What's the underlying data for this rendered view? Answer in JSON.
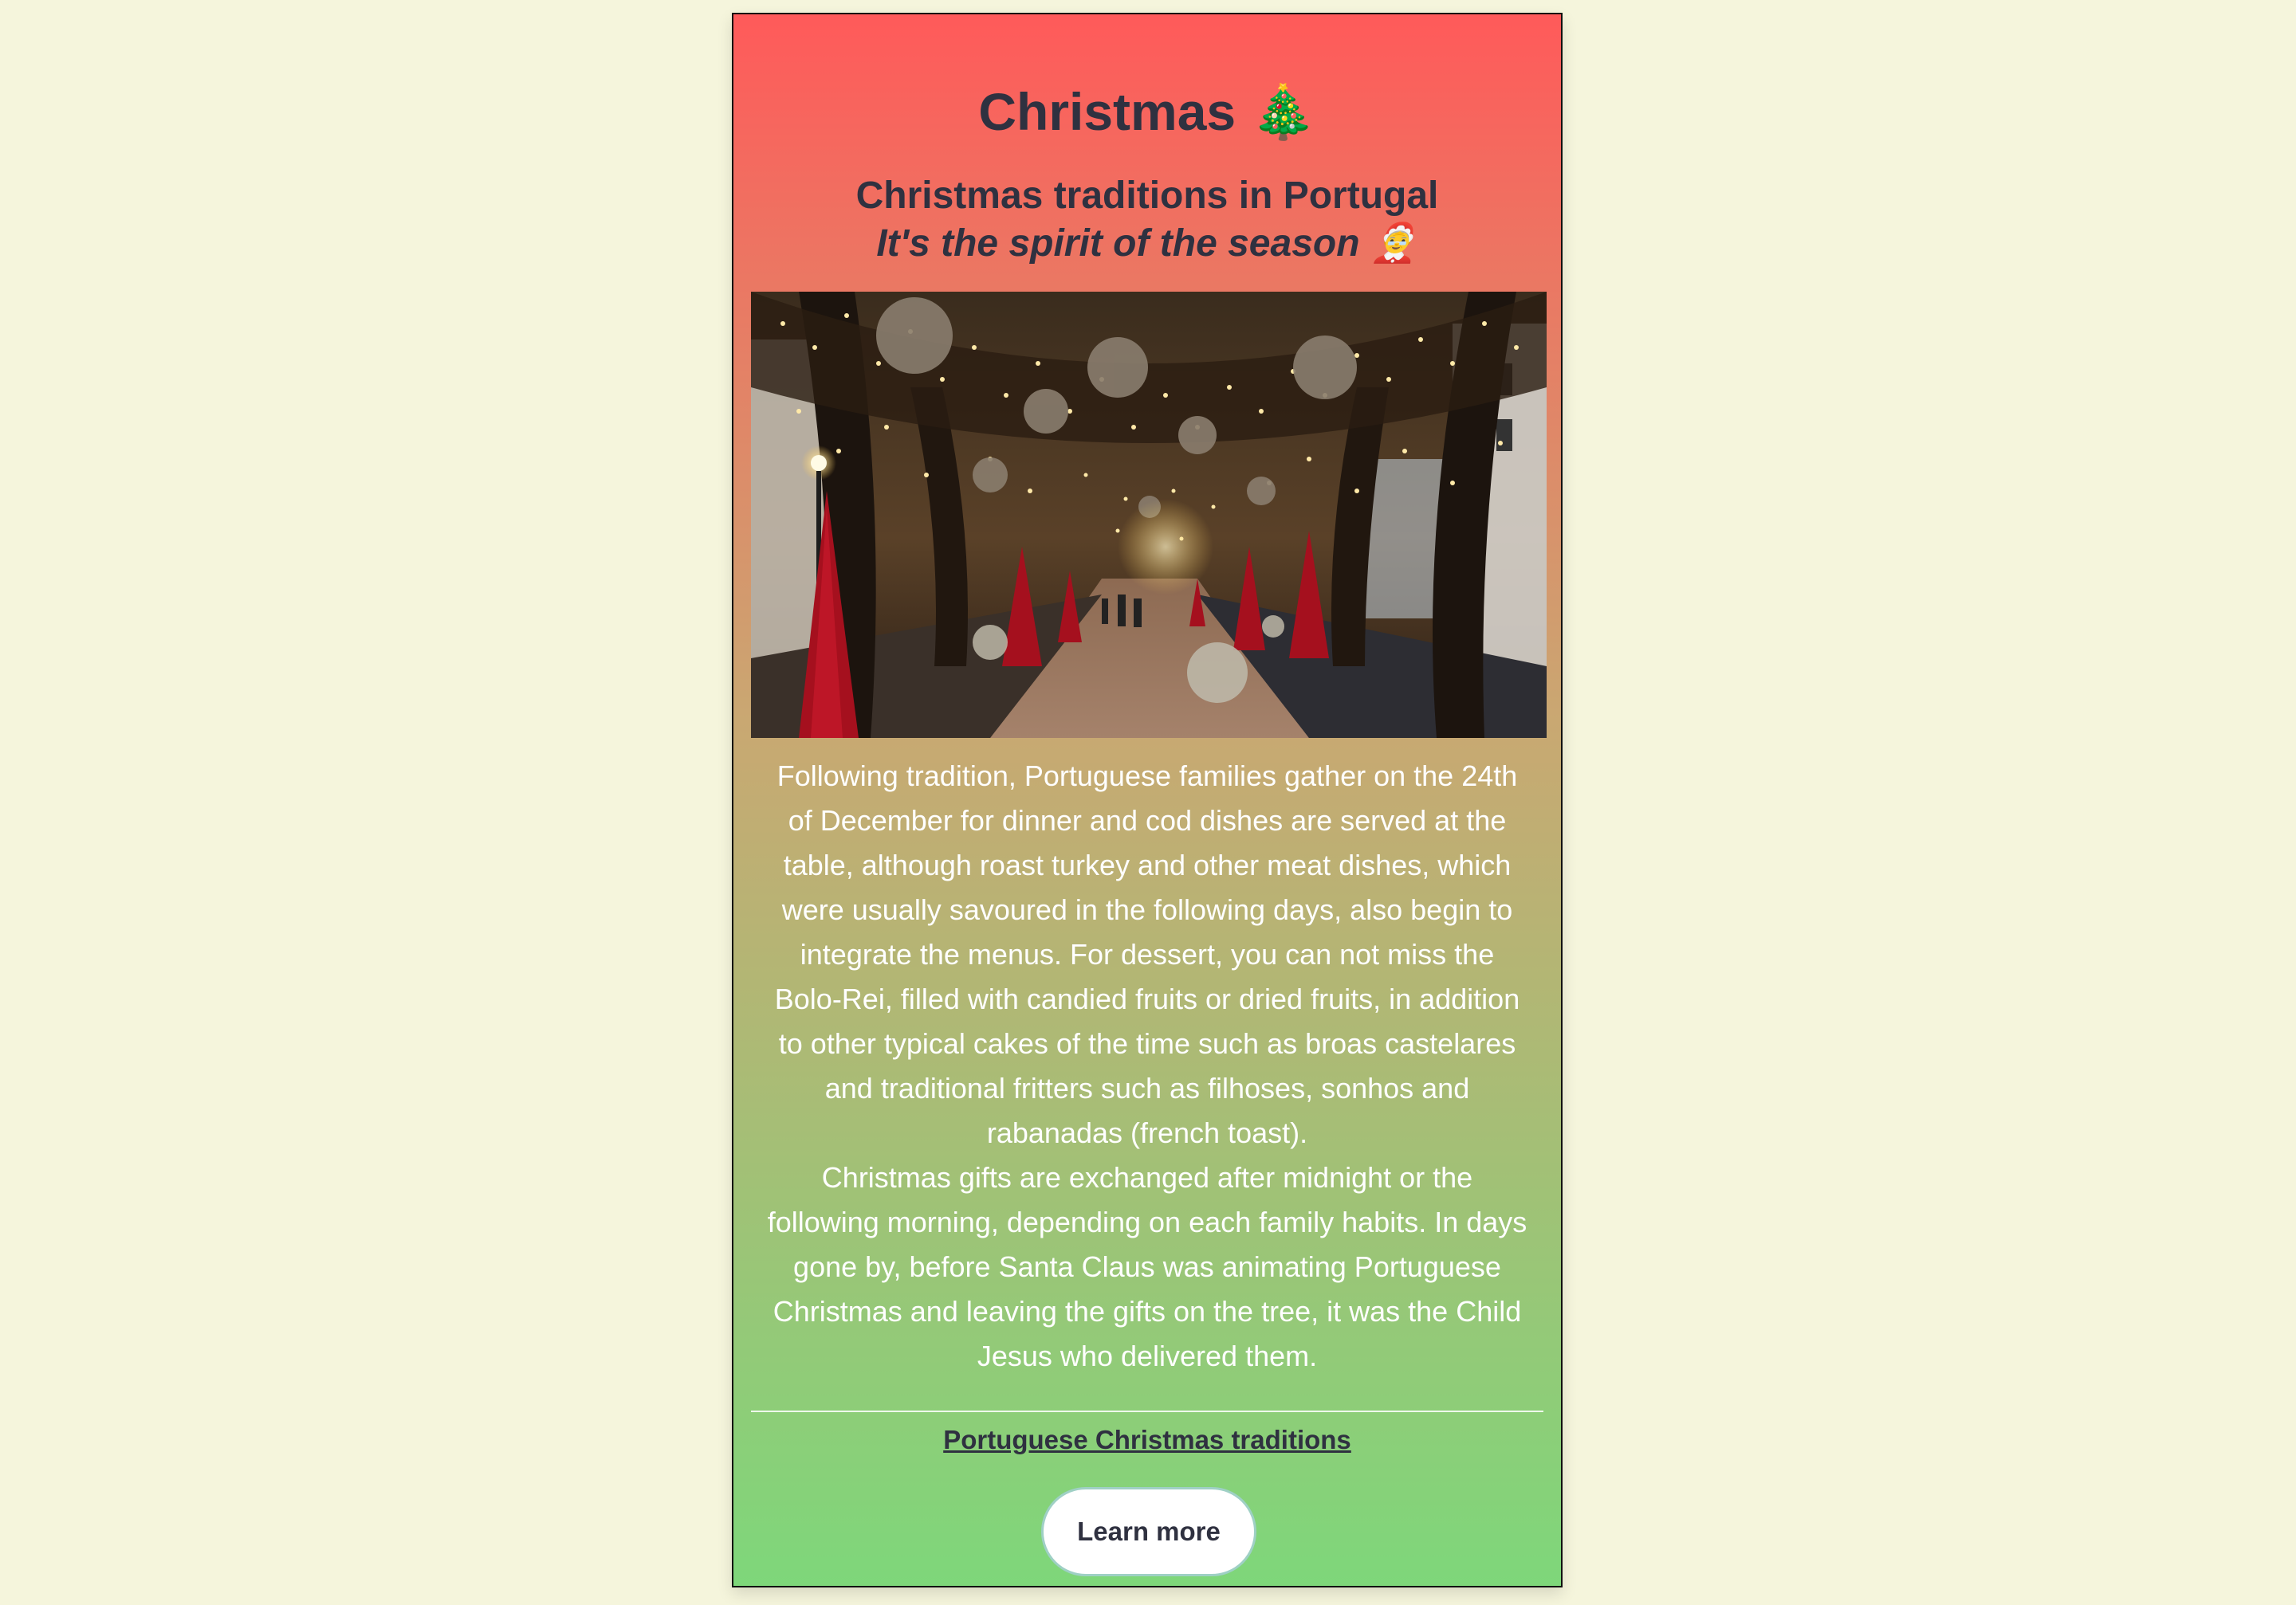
{
  "header": {
    "title": "Christmas 🎄",
    "subtitle": "Christmas traditions in Portugal",
    "tagline": "It's the spirit of the season 🤶"
  },
  "article": {
    "paragraph_1": "Following tradition, Portuguese families gather on the 24th of December for dinner and cod dishes are served at the table, although roast turkey and other meat dishes, which were usually savoured in the following days, also begin to integrate the menus. For dessert, you can not miss the Bolo-Rei, filled with candied fruits or dried fruits, in addition to other typical cakes of the time such as broas castelares and traditional fritters such as filhoses, sonhos and rabanadas (french toast).",
    "paragraph_2": "Christmas gifts are exchanged after midnight or the following morning, depending on each family habits. In days gone by, before Santa Claus was animating Portuguese Christmas and leaving the gifts on the tree, it was the Child Jesus who delivered them."
  },
  "footer": {
    "link_text": "Portuguese Christmas traditions",
    "button_label": "Learn more"
  },
  "colors": {
    "page_background": "#f5f5dc",
    "gradient_top": "#ff5a5a",
    "gradient_middle": "#c9a872",
    "gradient_bottom": "#7ed77a",
    "text_dark": "#2f3140",
    "text_light": "#ffffff"
  }
}
